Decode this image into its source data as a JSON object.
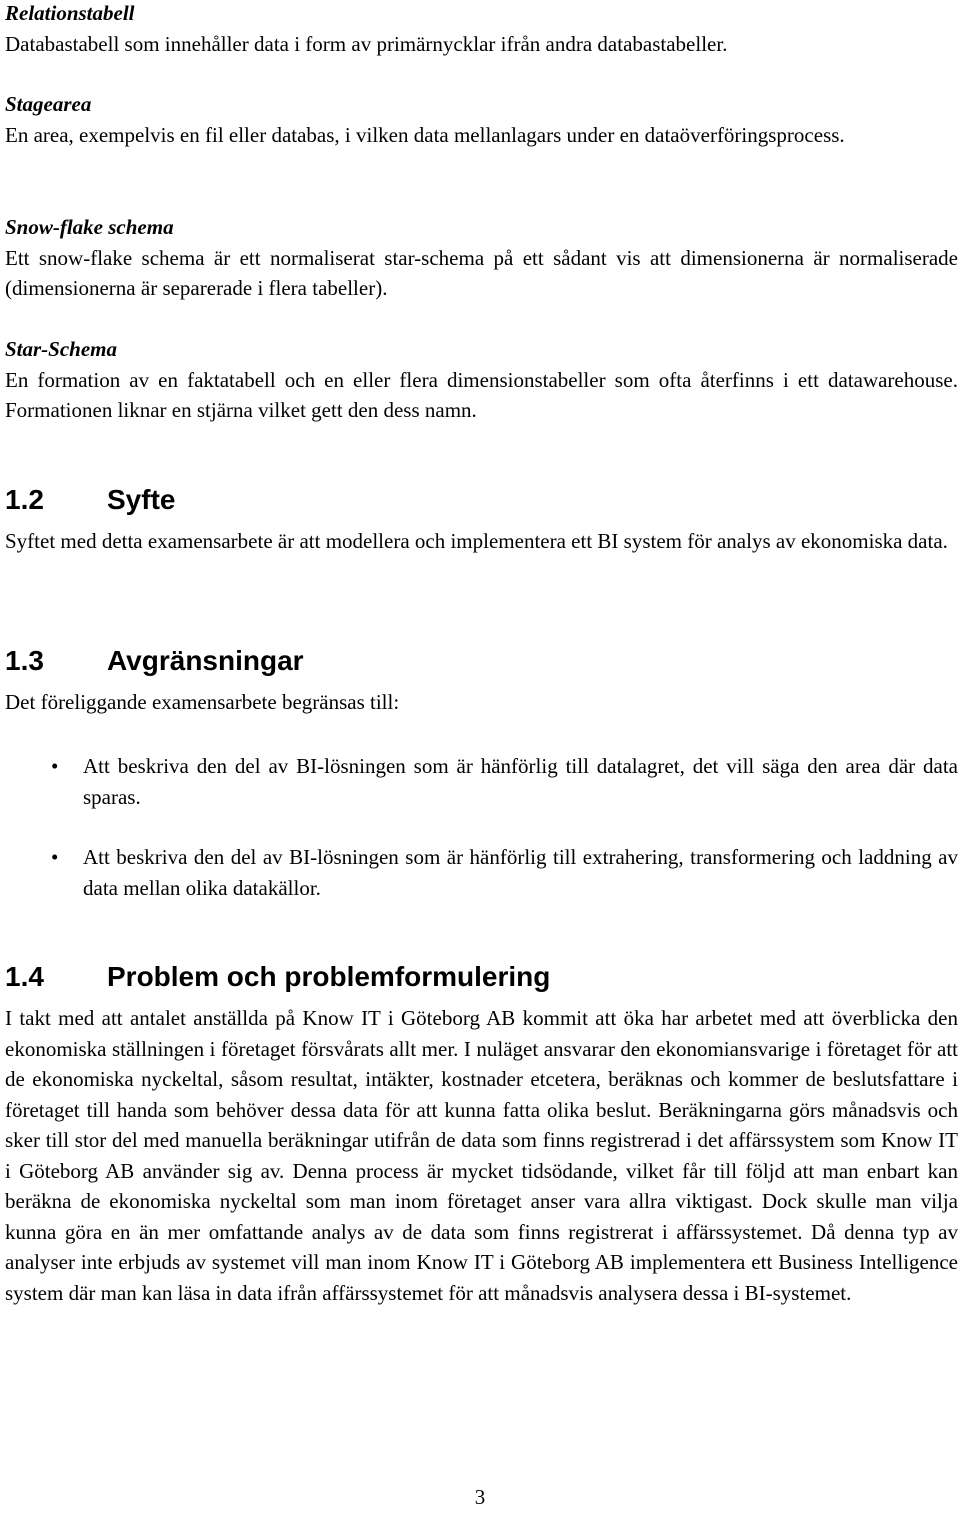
{
  "glossary": [
    {
      "term": "Relationstabell",
      "definition": "Databastabell som innehåller data i form av primärnycklar ifrån andra databastabeller."
    },
    {
      "term": "Stagearea",
      "definition": "En area, exempelvis en fil eller databas, i vilken data mellanlagars under en dataöverföringsprocess."
    },
    {
      "term": "Snow-flake schema",
      "definition": "Ett snow-flake schema är ett normaliserat star-schema på ett sådant vis att dimensionerna är normaliserade (dimensionerna är separerade i flera tabeller)."
    },
    {
      "term": "Star-Schema",
      "definition": "En formation av en faktatabell och en eller flera dimensionstabeller som ofta återfinns i ett datawarehouse. Formationen liknar en stjärna vilket gett den dess namn."
    }
  ],
  "sections": [
    {
      "number": "1.2",
      "title": "Syfte",
      "text": "Syftet med detta examensarbete är att modellera och implementera ett BI system för analys av ekonomiska data."
    },
    {
      "number": "1.3",
      "title": "Avgränsningar",
      "text": "Det föreliggande examensarbete begränsas till:",
      "bullets": [
        "Att beskriva den del av BI-lösningen som är hänförlig till datalagret, det vill säga den area där data sparas.",
        "Att beskriva den del av BI-lösningen som är hänförlig till extrahering, transformering och laddning av data mellan olika datakällor."
      ]
    },
    {
      "number": "1.4",
      "title": "Problem och problemformulering",
      "text": "I takt med att antalet anställda på Know IT i Göteborg AB kommit att öka har arbetet med att överblicka den ekonomiska ställningen i företaget försvårats allt mer. I nuläget ansvarar den ekonomiansvarige i företaget för att de ekonomiska nyckeltal, såsom resultat, intäkter, kostnader etcetera, beräknas och kommer de beslutsfattare i företaget till handa som behöver dessa data för att kunna fatta olika beslut. Beräkningarna görs månadsvis och sker till stor del med manuella beräkningar utifrån de data som finns registrerad i det affärssystem som Know IT i Göteborg AB använder sig av. Denna process är mycket tidsödande, vilket får till följd att man enbart kan beräkna de ekonomiska nyckeltal som man inom företaget anser vara allra viktigast. Dock skulle man vilja kunna göra en än mer omfattande analys av de data som finns registrerat i affärssystemet. Då denna typ av analyser inte erbjuds av systemet vill man inom Know IT i Göteborg AB implementera ett Business Intelligence system där man kan läsa in data ifrån affärssystemet för att månadsvis analysera dessa i BI-systemet."
    }
  ],
  "bullet_glyph": "•",
  "page_number": "3"
}
